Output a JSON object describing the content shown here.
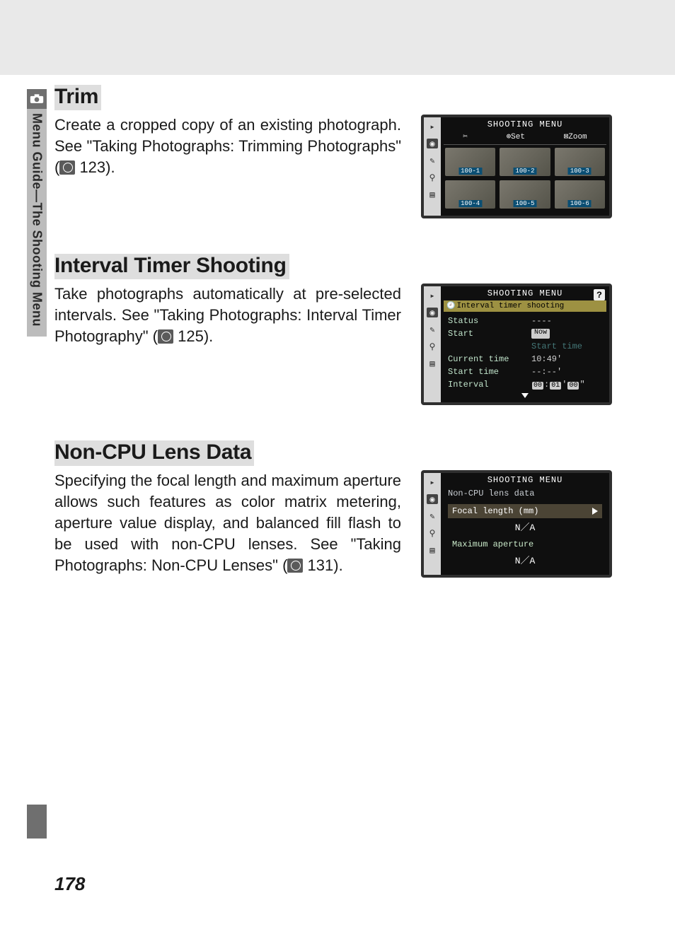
{
  "sidebar": {
    "label": "Menu Guide—The Shooting Menu"
  },
  "page_number": "178",
  "sections": {
    "trim": {
      "heading": "Trim",
      "body_pre": "Create a cropped copy of an existing photograph. See \"Taking Photographs: Trimming Photographs\" (",
      "page_ref": " 123).",
      "lcd": {
        "title": "SHOOTING MENU",
        "sub": {
          "cut": "✂",
          "set": "⊕Set",
          "zoom": "⊠Zoom"
        },
        "thumbs": [
          "100-1",
          "100-2",
          "100-3",
          "100-4",
          "100-5",
          "100-6"
        ]
      }
    },
    "interval": {
      "heading": "Interval Timer Shooting",
      "body_pre": "Take photographs automatically at pre-selected intervals. See \"Taking Photographs: Interval Timer Photography\" (",
      "page_ref": " 125).",
      "lcd": {
        "title": "SHOOTING MENU",
        "subtitle": "Interval timer shooting",
        "rows": {
          "status_k": "Status",
          "status_v": "----",
          "start_k": "Start",
          "start_v": "Now",
          "start_v2": "Start time",
          "curtime_k": "Current time",
          "curtime_v": "10:49'",
          "starttime_k": "Start time",
          "starttime_v": "--:--'",
          "interval_k": "Interval",
          "ih": "00",
          "im": "01",
          "is": "00"
        }
      }
    },
    "noncpu": {
      "heading": "Non-CPU Lens Data",
      "body_pre": "Specifying the focal length and maximum aperture allows such features as color matrix metering, aperture value display, and balanced fill flash to be used with non-CPU lenses. See \"Taking Photographs: Non-CPU Lenses\" (",
      "page_ref": " 131).",
      "lcd": {
        "title": "SHOOTING MENU",
        "subtitle": "Non-CPU lens data",
        "focal_label": "Focal length (mm)",
        "focal_value": "N／A",
        "aperture_label": "Maximum aperture",
        "aperture_value": "N／A"
      }
    }
  }
}
